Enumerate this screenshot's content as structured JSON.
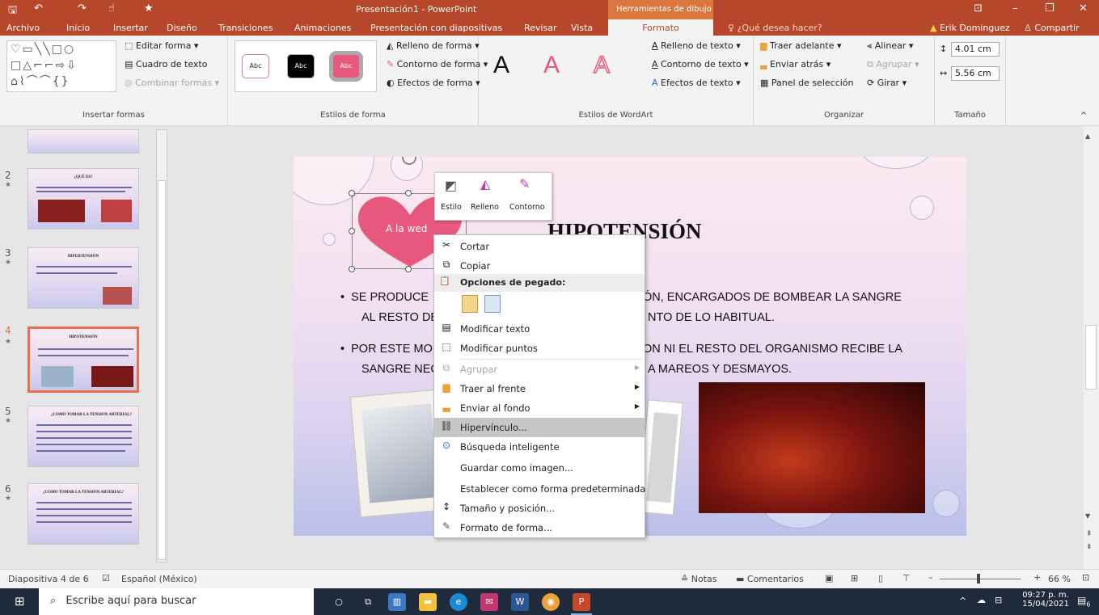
{
  "titlebar": {
    "title": "Presentación1 - PowerPoint",
    "context_tab": "Herramientas de dibujo",
    "quick_save": "🖫",
    "quick_undo": "↶",
    "quick_redo": "↷",
    "quick_touch": "☝",
    "quick_customize": "★",
    "win_ribbon": "⊡",
    "win_min": "–",
    "win_max": "❐",
    "win_close": "✕"
  },
  "tabs": {
    "archivo": "Archivo",
    "inicio": "Inicio",
    "insertar": "Insertar",
    "diseno": "Diseño",
    "transiciones": "Transiciones",
    "animaciones": "Animaciones",
    "presentacion": "Presentación con diapositivas",
    "revisar": "Revisar",
    "vista": "Vista",
    "formato": "Formato",
    "tell_me": "¿Qué desea hacer?",
    "user": "Erik Dominguez",
    "share": "Compartir"
  },
  "ribbon": {
    "insertar_formas": {
      "label": "Insertar formas",
      "edit_shape": "Editar forma",
      "text_box": "Cuadro de texto",
      "merge_shapes": "Combinar formas"
    },
    "estilos_forma": {
      "label": "Estilos de forma",
      "sample": "Abc",
      "fill": "Relleno de forma",
      "outline": "Contorno de forma",
      "effects": "Efectos de forma"
    },
    "wordart": {
      "label": "Estilos de WordArt",
      "letter": "A",
      "text_fill": "Relleno de texto",
      "text_outline": "Contorno de texto",
      "text_effects": "Efectos de texto"
    },
    "organizar": {
      "label": "Organizar",
      "bring_forward": "Traer adelante",
      "send_backward": "Enviar atrás",
      "selection_pane": "Panel de selección",
      "align": "Alinear",
      "group": "Agrupar",
      "rotate": "Girar"
    },
    "tamano": {
      "label": "Tamaño",
      "height": "4.01 cm",
      "width": "5.56 cm"
    }
  },
  "slides_panel": [
    {
      "num": "2",
      "title": "¿QUÉ ES?"
    },
    {
      "num": "3",
      "title": "HIPERTENSIÓN"
    },
    {
      "num": "4",
      "title": "HIPOTENSIÓN"
    },
    {
      "num": "5",
      "title": "¿COMO TOMAR LA TENSION ARTERIAL?"
    },
    {
      "num": "6",
      "title": "¿COMO TOMAR LA TENSION ARTERIAL?"
    }
  ],
  "slide": {
    "title": "HIPOTENSIÓN",
    "heart_text": "A la wed",
    "bullet1_line1": "SE PRODUCE",
    "bullet1_line1b": "ÓN, ENCARGADOS DE BOMBEAR LA SANGRE",
    "bullet1_line2": "AL RESTO DE",
    "bullet1_line2b": "NTO DE LO HABITUAL.",
    "bullet2_line1": "POR ESTE MO",
    "bullet2_line1b": "ON NI EL RESTO DEL ORGANISMO RECIBE LA",
    "bullet2_line2": "SANGRE NEC",
    "bullet2_line2b": "A MAREOS Y DESMAYOS."
  },
  "mini_toolbar": {
    "style": "Estilo",
    "fill": "Relleno",
    "outline": "Contorno"
  },
  "context_menu": {
    "cut": "Cortar",
    "copy": "Copiar",
    "paste_options": "Opciones de pegado:",
    "edit_text": "Modificar texto",
    "edit_points": "Modificar puntos",
    "group": "Agrupar",
    "bring_front": "Traer al frente",
    "send_back": "Enviar al fondo",
    "hyperlink": "Hipervínculo...",
    "smart_lookup": "Búsqueda inteligente",
    "save_image": "Guardar como imagen...",
    "set_default": "Establecer como forma predeterminada",
    "size_position": "Tamaño y posición...",
    "format_shape": "Formato de forma..."
  },
  "status": {
    "slide_count": "Diapositiva 4 de 6",
    "language": "Español (México)",
    "notes": "Notas",
    "comments": "Comentarios",
    "zoom": "66 %"
  },
  "taskbar": {
    "search": "Escribe aquí para buscar",
    "time": "09:27 p. m.",
    "date": "15/04/2021",
    "notif": "6"
  },
  "colors": {
    "accent": "#b7472a",
    "context_tab": "#d9773f",
    "heart": "#e8577c"
  }
}
